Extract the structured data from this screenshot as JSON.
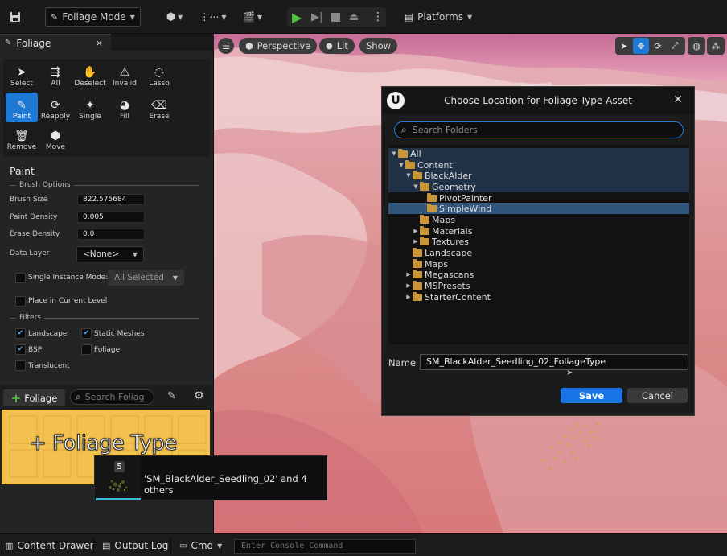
{
  "toolbar": {
    "mode_label": "Foliage Mode",
    "platforms_label": "Platforms"
  },
  "panel_tab": {
    "label": "Foliage",
    "close_glyph": "×"
  },
  "tools": [
    {
      "label": "Select",
      "icon": "cursor-icon",
      "glyph": "➤"
    },
    {
      "label": "All",
      "icon": "select-all-icon",
      "glyph": "⇶"
    },
    {
      "label": "Deselect",
      "icon": "deselect-hand-icon",
      "glyph": "✋"
    },
    {
      "label": "Invalid",
      "icon": "invalid-icon",
      "glyph": "⚠"
    },
    {
      "label": "Lasso",
      "icon": "lasso-icon",
      "glyph": "◌"
    },
    {
      "label": "Paint",
      "icon": "paint-brush-icon",
      "glyph": "✎"
    },
    {
      "label": "Reapply",
      "icon": "reapply-icon",
      "glyph": "⟳"
    },
    {
      "label": "Single",
      "icon": "single-icon",
      "glyph": "✦"
    },
    {
      "label": "Fill",
      "icon": "fill-bucket-icon",
      "glyph": "◕"
    },
    {
      "label": "Erase",
      "icon": "eraser-icon",
      "glyph": "⌫"
    },
    {
      "label": "Remove",
      "icon": "trash-icon",
      "glyph": "🗑"
    },
    {
      "label": "Move",
      "icon": "move-icon",
      "glyph": "⬢"
    }
  ],
  "paint": {
    "title": "Paint",
    "brush_options_header": "Brush Options",
    "brush_size_label": "Brush Size",
    "brush_size_value": "822.575684",
    "paint_density_label": "Paint Density",
    "paint_density_value": "0.005",
    "erase_density_label": "Erase Density",
    "erase_density_value": "0.0",
    "data_layer_label": "Data Layer",
    "data_layer_value": "<None>",
    "single_instance_label": "Single Instance Mode:",
    "single_instance_value": "All Selected",
    "place_in_level_label": "Place in Current Level",
    "filters_header": "Filters",
    "filters": {
      "landscape": "Landscape",
      "static_meshes": "Static Meshes",
      "bsp": "BSP",
      "foliage": "Foliage",
      "translucent": "Translucent"
    }
  },
  "foliage_bar": {
    "add_label": "Foliage",
    "search_placeholder": "Search Foliag"
  },
  "drop_area": {
    "label": "+ Foliage Type"
  },
  "drag_tooltip": {
    "count": "5",
    "text": "'SM_BlackAlder_Seedling_02' and 4 others"
  },
  "viewport": {
    "perspective_label": "Perspective",
    "lit_label": "Lit",
    "show_label": "Show"
  },
  "dialog": {
    "title": "Choose Location for Foliage Type Asset",
    "logo": "U",
    "search_placeholder": "Search Folders",
    "tree": [
      {
        "label": "All",
        "depth": 0,
        "expanded": true
      },
      {
        "label": "Content",
        "depth": 1,
        "expanded": true
      },
      {
        "label": "BlackAlder",
        "depth": 2,
        "expanded": true
      },
      {
        "label": "Geometry",
        "depth": 3,
        "expanded": true
      },
      {
        "label": "PivotPainter",
        "depth": 4,
        "expanded": null
      },
      {
        "label": "SimpleWind",
        "depth": 4,
        "expanded": null,
        "selected": true
      },
      {
        "label": "Maps",
        "depth": 3,
        "expanded": null
      },
      {
        "label": "Materials",
        "depth": 3,
        "expanded": false
      },
      {
        "label": "Textures",
        "depth": 3,
        "expanded": false
      },
      {
        "label": "Landscape",
        "depth": 2,
        "expanded": null
      },
      {
        "label": "Maps",
        "depth": 2,
        "expanded": null
      },
      {
        "label": "Megascans",
        "depth": 2,
        "expanded": false
      },
      {
        "label": "MSPresets",
        "depth": 2,
        "expanded": false
      },
      {
        "label": "StarterContent",
        "depth": 2,
        "expanded": false
      }
    ],
    "name_label": "Name",
    "name_value": "SM_BlackAlder_Seedling_02_FoliageType",
    "save_label": "Save",
    "cancel_label": "Cancel"
  },
  "bottom_bar": {
    "content_drawer": "Content Drawer",
    "output_log": "Output Log",
    "cmd": "Cmd",
    "console_placeholder": "Enter Console Command"
  },
  "colors": {
    "accent": "#1e78d6",
    "drop_area": "#f3c24e",
    "play_green": "#4ec342"
  }
}
